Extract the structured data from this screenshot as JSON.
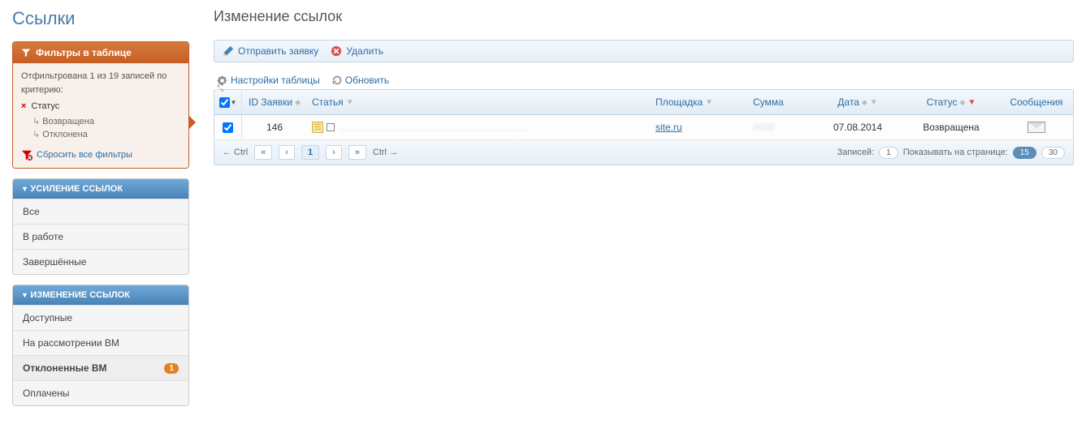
{
  "sidebar": {
    "title": "Ссылки",
    "filter_panel": {
      "header": "Фильтры в таблице",
      "summary": "Отфильтрована 1 из 19 записей по критерию:",
      "criterion": "Статус",
      "values": [
        "Возвращена",
        "Отклонена"
      ],
      "reset": "Сбросить все фильтры"
    },
    "nav1": {
      "header": "УСИЛЕНИЕ ССЫЛОК",
      "items": [
        {
          "label": "Все",
          "badge": null,
          "active": false
        },
        {
          "label": "В работе",
          "badge": null,
          "active": false
        },
        {
          "label": "Завершённые",
          "badge": null,
          "active": false
        }
      ]
    },
    "nav2": {
      "header": "ИЗМЕНЕНИЕ ССЫЛОК",
      "items": [
        {
          "label": "Доступные",
          "badge": null,
          "active": false
        },
        {
          "label": "На рассмотрении ВМ",
          "badge": null,
          "active": false
        },
        {
          "label": "Отклоненные ВМ",
          "badge": "1",
          "active": true
        },
        {
          "label": "Оплачены",
          "badge": null,
          "active": false
        }
      ]
    }
  },
  "main": {
    "title": "Изменение ссылок",
    "toolbar": {
      "send": "Отправить заявку",
      "delete": "Удалить"
    },
    "controls": {
      "settings": "Настройки таблицы",
      "refresh": "Обновить"
    },
    "columns": {
      "id": "ID Заявки",
      "article": "Статья",
      "site": "Площадка",
      "sum": "Сумма",
      "date": "Дата",
      "status": "Статус",
      "msg": "Сообщения"
    },
    "rows": [
      {
        "id": "146",
        "article": "………………………………………………",
        "site": "site.ru",
        "sum": "////////",
        "date": "07.08.2014",
        "status": "Возвращена"
      }
    ],
    "footer": {
      "ctrl_left": "← Ctrl",
      "ctrl_right": "Ctrl →",
      "page": "1",
      "records_label": "Записей:",
      "records_count": "1",
      "per_page_label": "Показывать на странице:",
      "per_page_options": [
        "15",
        "30"
      ],
      "per_page_active": "15"
    }
  }
}
